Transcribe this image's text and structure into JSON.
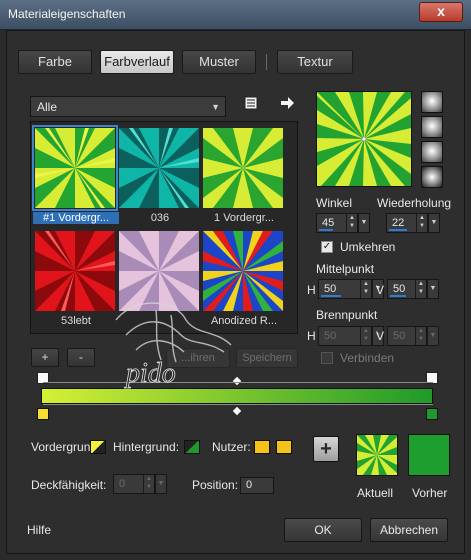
{
  "window": {
    "title": "Materialeigenschaften",
    "close_glyph": "x"
  },
  "tabs": [
    {
      "label": "Farbe"
    },
    {
      "label": "Farbverlauf"
    },
    {
      "label": "Muster"
    },
    {
      "label": "Textur"
    }
  ],
  "library": {
    "filter_value": "Alle",
    "items": [
      {
        "label": "#1 Vordergr...",
        "selected": true
      },
      {
        "label": "036"
      },
      {
        "label": "1 Vordergr..."
      },
      {
        "label": "53lebt"
      },
      {
        "label": ""
      },
      {
        "label": "Anodized R..."
      }
    ],
    "add_label": "+",
    "remove_label": "-",
    "button_disabled_1": "...ihren",
    "save_label": "Speichern"
  },
  "settings": {
    "angle_label": "Winkel",
    "angle_value": "45",
    "repeat_label": "Wiederholung",
    "repeat_value": "22",
    "invert_label": "Umkehren",
    "invert_checked": true,
    "center_label": "Mittelpunkt",
    "center_h_label": "H",
    "center_h_value": "50",
    "center_v_label": "V",
    "center_v_value": "50",
    "focal_label": "Brennpunkt",
    "focal_h_label": "H",
    "focal_h_value": "50",
    "focal_v_label": "V",
    "focal_v_value": "50",
    "link_label": "Verbinden",
    "link_checked": false
  },
  "editor": {
    "gradient_start": "#d6f034",
    "gradient_end": "#1f9a2a",
    "foreground_label": "Vordergrund:",
    "background_label": "Hintergrund:",
    "user_label": "Nutzer:",
    "user_color": "#f5c21a",
    "opacity_label": "Deckfähigkeit:",
    "opacity_value": "0",
    "position_label": "Position:",
    "position_value": "0"
  },
  "preview": {
    "current_label": "Aktuell",
    "previous_label": "Vorher",
    "previous_color": "#1d9e2e"
  },
  "footer": {
    "help_label": "Hilfe",
    "ok_label": "OK",
    "cancel_label": "Abbrechen"
  },
  "watermark_text": "pido"
}
